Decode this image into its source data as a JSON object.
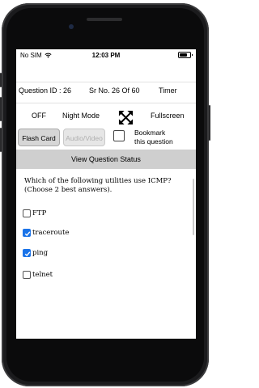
{
  "status_bar": {
    "carrier": "No SIM",
    "time": "12:03 PM"
  },
  "question_info": {
    "question_id": "Question ID : 26",
    "sr_no": "Sr No. 26 Of 60",
    "timer_label": "Timer"
  },
  "controls": {
    "night_mode_state": "OFF",
    "night_mode_label": "Night Mode",
    "fullscreen_label": "Fullscreen"
  },
  "actions": {
    "flash_card": "Flash Card",
    "audio_video": "Audio/Video",
    "bookmark_line1": "Bookmark",
    "bookmark_line2": "this question",
    "view_status": "View Question Status"
  },
  "question": {
    "text": "Which of the following utilities use ICMP? (Choose 2 best answers)."
  },
  "options": [
    {
      "label": "FTP",
      "checked": false
    },
    {
      "label": "traceroute",
      "checked": true
    },
    {
      "label": "ping",
      "checked": true
    },
    {
      "label": "telnet",
      "checked": false
    }
  ],
  "colors": {
    "checkbox_checked": "#1a73e8",
    "view_status_bg": "#cfcfcf"
  }
}
